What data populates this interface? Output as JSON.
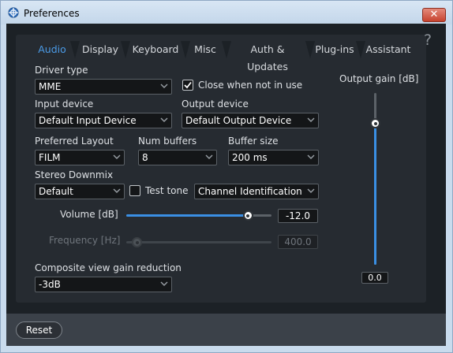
{
  "window": {
    "title": "Preferences",
    "close_glyph": "✕"
  },
  "help_glyph": "?",
  "tabs": [
    {
      "label": "Audio",
      "active": true
    },
    {
      "label": "Display",
      "active": false
    },
    {
      "label": "Keyboard",
      "active": false
    },
    {
      "label": "Misc",
      "active": false
    },
    {
      "label": "Auth & Updates",
      "active": false
    },
    {
      "label": "Plug-ins",
      "active": false
    },
    {
      "label": "Assistant",
      "active": false
    }
  ],
  "audio": {
    "driver_type": {
      "label": "Driver type",
      "value": "MME"
    },
    "close_when_not_in_use": {
      "label": "Close when not in use",
      "checked": true
    },
    "input_device": {
      "label": "Input device",
      "value": "Default Input Device"
    },
    "output_device": {
      "label": "Output device",
      "value": "Default Output Device"
    },
    "preferred_layout": {
      "label": "Preferred Layout",
      "value": "FILM"
    },
    "num_buffers": {
      "label": "Num buffers",
      "value": "8"
    },
    "buffer_size": {
      "label": "Buffer size",
      "value": "200 ms"
    },
    "stereo_downmix": {
      "label": "Stereo Downmix",
      "value": "Default"
    },
    "test_tone": {
      "label": "Test tone",
      "checked": false
    },
    "test_tone_signal": {
      "value": "Channel Identification"
    },
    "volume": {
      "label": "Volume [dB]",
      "value": "-12.0",
      "level": 0.84
    },
    "frequency": {
      "label": "Frequency [Hz]",
      "value": "400.0",
      "level": 0.0,
      "enabled": false
    },
    "composite_gain_reduction": {
      "label": "Composite view gain reduction",
      "value": "-3dB"
    },
    "output_gain": {
      "label": "Output gain [dB]",
      "value": "0.0",
      "level": 0.82
    }
  },
  "footer": {
    "reset_label": "Reset"
  },
  "colors": {
    "accent": "#3a8fe4",
    "active_tab": "#4b9be7",
    "panel_bg": "#262b31",
    "window_bg": "#1c2126"
  },
  "icons": {
    "app": "crosshair-globe-icon",
    "close": "close-icon",
    "help": "help-icon",
    "dropdown": "chevron-down-icon",
    "check": "checkmark-icon"
  }
}
